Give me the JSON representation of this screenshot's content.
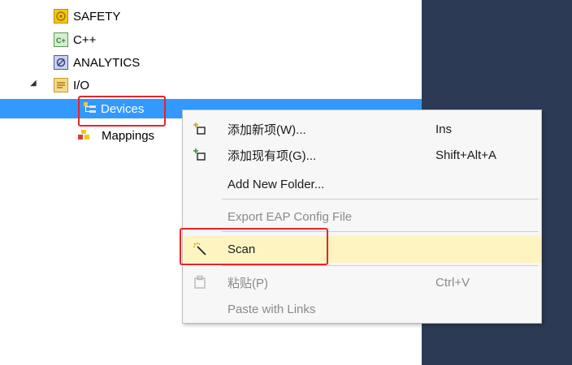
{
  "tree": {
    "items": [
      {
        "label": "SAFETY",
        "icon": "safety-icon"
      },
      {
        "label": "C++",
        "icon": "cpp-icon"
      },
      {
        "label": "ANALYTICS",
        "icon": "analytics-icon"
      },
      {
        "label": "I/O",
        "icon": "io-folder-icon"
      },
      {
        "label": "Devices",
        "icon": "devices-icon"
      },
      {
        "label": "Mappings",
        "icon": "mappings-icon"
      }
    ]
  },
  "context_menu": {
    "items": [
      {
        "label": "添加新项(W)...",
        "shortcut": "Ins",
        "icon": "add-new-item-icon",
        "enabled": true
      },
      {
        "label": "添加现有项(G)...",
        "shortcut": "Shift+Alt+A",
        "icon": "add-existing-item-icon",
        "enabled": true
      },
      {
        "label": "Add New Folder...",
        "shortcut": "",
        "icon": "",
        "enabled": true
      },
      {
        "label": "Export EAP Config File",
        "shortcut": "",
        "icon": "",
        "enabled": false
      },
      {
        "label": "Scan",
        "shortcut": "",
        "icon": "magic-wand-icon",
        "enabled": true,
        "highlighted": true
      },
      {
        "label": "粘贴(P)",
        "shortcut": "Ctrl+V",
        "icon": "paste-icon",
        "enabled": false
      },
      {
        "label": "Paste with Links",
        "shortcut": "",
        "icon": "",
        "enabled": false
      }
    ]
  },
  "colors": {
    "selection": "#3399ff",
    "annotation_red": "#e8232b",
    "menu_highlight": "#fdf4c2",
    "right_pane": "#2d3a55"
  }
}
